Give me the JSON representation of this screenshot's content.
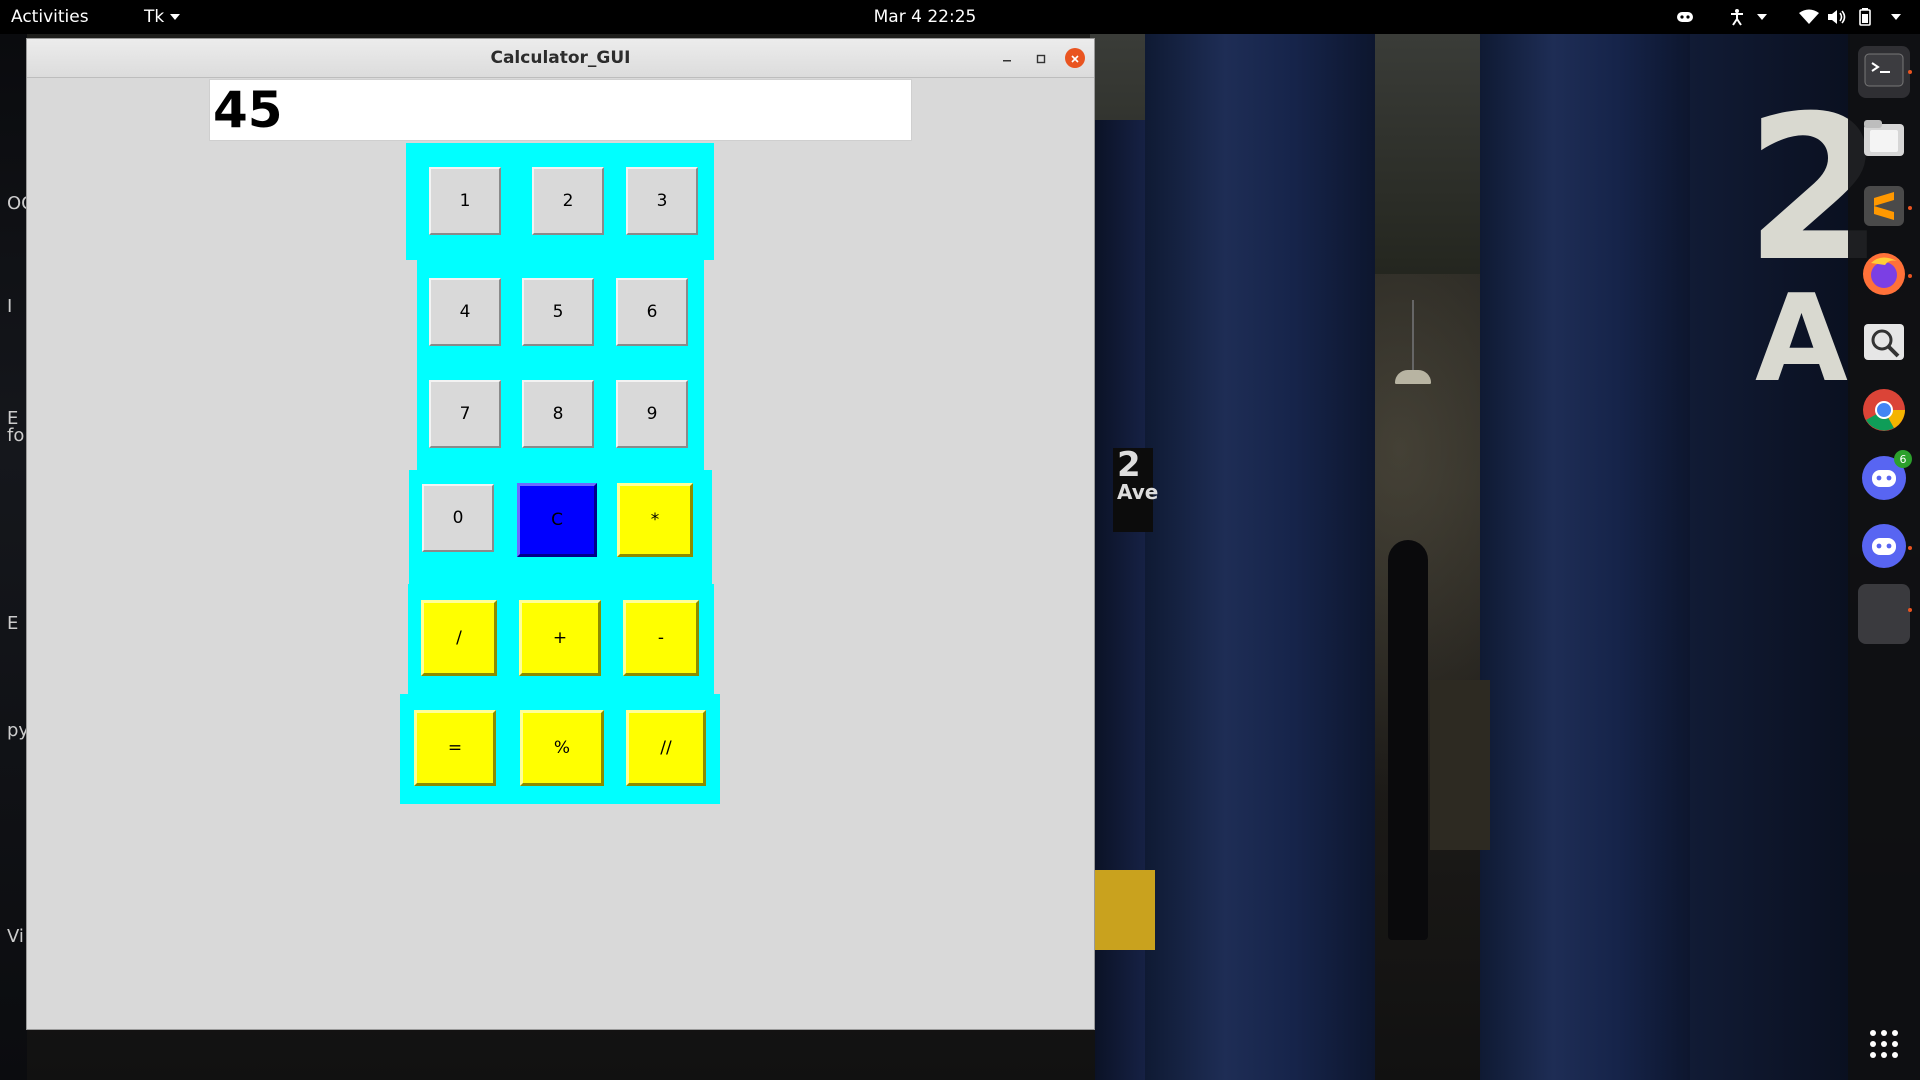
{
  "topbar": {
    "activities_label": "Activities",
    "app_menu_label": "Tk",
    "clock": "Mar 4  22:25",
    "tray_icons": [
      "discord-tray-icon",
      "accessibility-icon",
      "network-wifi-icon",
      "volume-icon",
      "battery-icon",
      "system-menu-arrow-icon"
    ]
  },
  "desktop": {
    "left_peek_texts": [
      "OC",
      "I",
      "E",
      "fo",
      "E",
      "py",
      "Vi"
    ],
    "sign_big_top": "2",
    "sign_big_bottom": "A",
    "sign_small_number": "2",
    "sign_small_text": "Ave"
  },
  "window": {
    "title": "Calculator_GUI",
    "display_value": "45",
    "buttons": {
      "b1": "1",
      "b2": "2",
      "b3": "3",
      "b4": "4",
      "b5": "5",
      "b6": "6",
      "b7": "7",
      "b8": "8",
      "b9": "9",
      "b0": "0",
      "clear": "C",
      "multiply": "*",
      "divide": "/",
      "plus": "+",
      "minus": "-",
      "equals": "=",
      "modulo": "%",
      "floor_divide": "//"
    }
  },
  "dock": {
    "items": [
      "terminal-icon",
      "files-icon",
      "sublime-text-icon",
      "firefox-icon",
      "image-viewer-icon",
      "chrome-icon",
      "discord-icon",
      "discord-icon",
      "blank-app-icon"
    ],
    "discord_badge": "6"
  },
  "colors": {
    "row_background": "#00ffff",
    "operator_button": "#ffff00",
    "clear_button": "#0000ff",
    "digit_button": "#d9d9d9",
    "close_button": "#e95420"
  }
}
